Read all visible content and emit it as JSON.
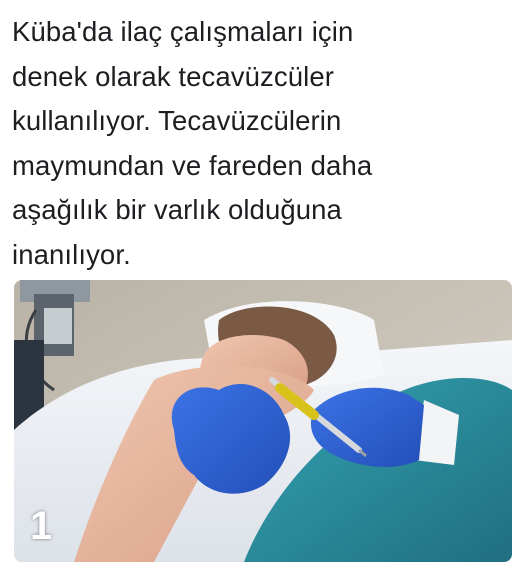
{
  "post": {
    "lines": [
      "Küba'da ilaç çalışmaları için",
      "denek olarak tecavüzcüler",
      "kullanılıyor. Tecavüzcülerin",
      "maymundan ve fareden daha",
      "aşağılık bir varlık olduğuna",
      "inanılıyor."
    ]
  },
  "photo": {
    "badge": "1",
    "colors": {
      "wall": "#d9d2c8",
      "sheet": "#eceff3",
      "glove": "#2f62d4",
      "gown": "#2c8fa0",
      "skin": "#e6b59e",
      "hair": "#7a5a44"
    }
  }
}
